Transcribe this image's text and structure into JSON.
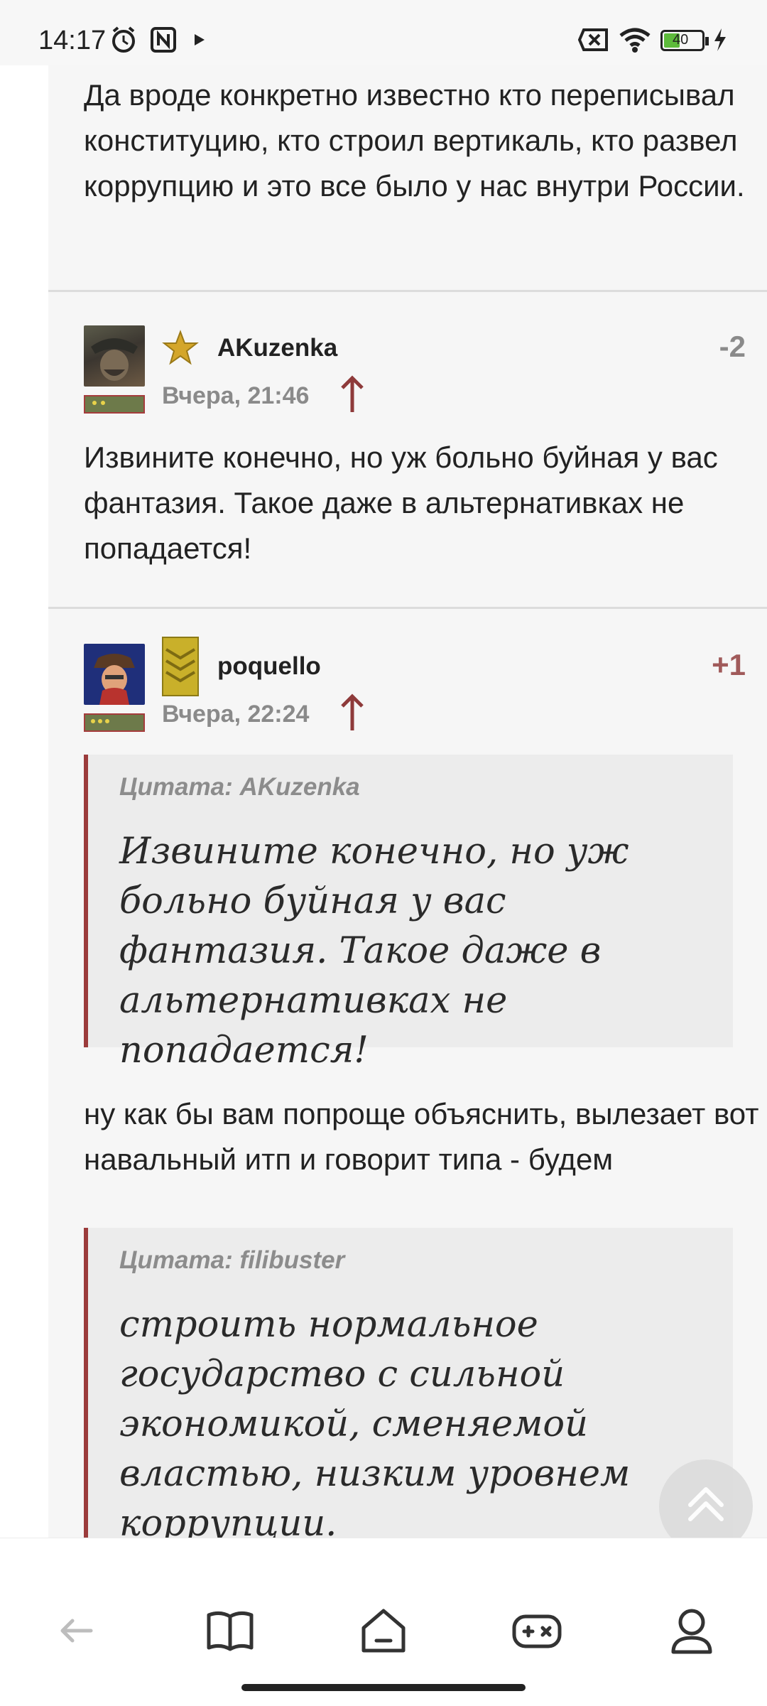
{
  "status_bar": {
    "time": "14:17",
    "battery_level": "40"
  },
  "post_top": {
    "text": "Да вроде конкретно известно кто переписывал конституцию, кто строил вертикаль, кто развел коррупцию и это все было у нас внутри России."
  },
  "comments": [
    {
      "username": "AKuzenka",
      "date": "Вчера, 21:46",
      "score": "-2",
      "score_color": "#8a8a8a",
      "text": "Извините конечно, но уж больно буйная у вас фантазия. Такое даже в альтернативках не попадается!"
    },
    {
      "username": "poquello",
      "date": "Вчера, 22:24",
      "score": "+1",
      "score_color": "#a05a5a",
      "quote1_author": "Цитата: AKuzenka",
      "quote1_text": "Извините конечно, но уж больно буйная у вас фантазия. Такое даже в альтернативках не попадается!",
      "text": "ну как бы вам попроще объяснить, вылезает вот навальный итп и говорит типа - будем",
      "quote2_author": "Цитата: filibuster",
      "quote2_text": "строить нормальное государство с сильной экономикой, сменяемой властью, низким уровнем коррупции."
    }
  ],
  "nav": {
    "items": [
      "back-icon",
      "book-icon",
      "home-icon",
      "gamepad-icon",
      "profile-icon"
    ]
  },
  "colors": {
    "accent": "#9b3b3b",
    "background": "#f6f6f6"
  }
}
